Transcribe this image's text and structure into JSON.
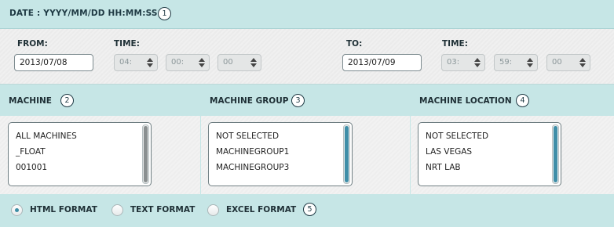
{
  "header": {
    "title": "DATE : YYYY/MM/DD HH:MM:SS",
    "badge": "1"
  },
  "from": {
    "label": "FROM:",
    "date": "2013/07/08",
    "time_label": "TIME:",
    "hour": "04:",
    "minute": "00:",
    "second": "00"
  },
  "to": {
    "label": "TO:",
    "date": "2013/07/09",
    "time_label": "TIME:",
    "hour": "03:",
    "minute": "59:",
    "second": "00"
  },
  "machine": {
    "title": "MACHINE",
    "badge": "2",
    "items": [
      "ALL MACHINES",
      "_FLOAT",
      "001001"
    ]
  },
  "machine_group": {
    "title": "MACHINE GROUP",
    "badge": "3",
    "items": [
      "NOT SELECTED",
      "MACHINEGROUP1",
      "MACHINEGROUP3"
    ]
  },
  "machine_location": {
    "title": "MACHINE LOCATION",
    "badge": "4",
    "items": [
      "NOT SELECTED",
      "LAS VEGAS",
      "NRT LAB"
    ]
  },
  "format": {
    "badge": "5",
    "options": [
      {
        "label": "HTML FORMAT",
        "selected": true
      },
      {
        "label": "TEXT FORMAT",
        "selected": false
      },
      {
        "label": "EXCEL FORMAT",
        "selected": false
      }
    ]
  },
  "colors": {
    "band": "#c6e6e6",
    "scroll_thumb_active": "#3f8ea8",
    "scroll_thumb_inactive": "#8a8f90",
    "radio_dot": "#3c8ea5"
  }
}
